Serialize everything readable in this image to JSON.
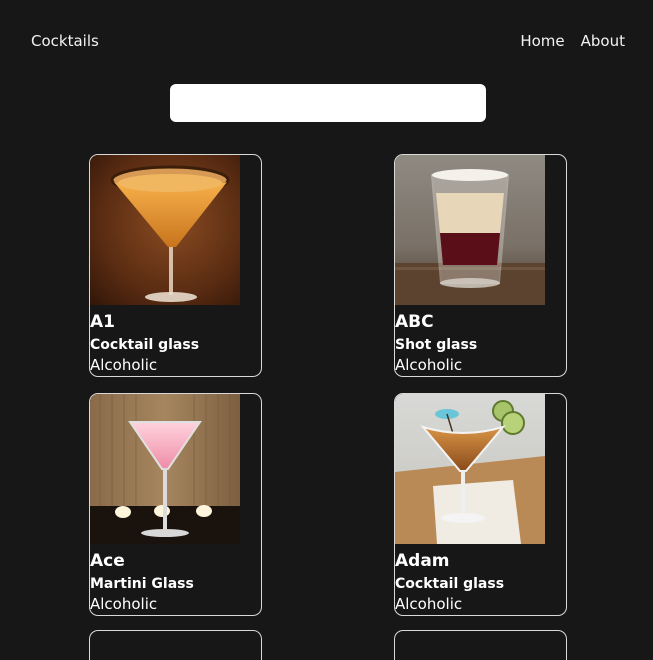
{
  "nav": {
    "brand": "Cocktails",
    "links": [
      {
        "label": "Home"
      },
      {
        "label": "About"
      }
    ]
  },
  "search": {
    "value": "",
    "placeholder": ""
  },
  "drinks": [
    {
      "name": "A1",
      "glass": "Cocktail glass",
      "type": "Alcoholic",
      "image": "amber-martini-photo"
    },
    {
      "name": "ABC",
      "glass": "Shot glass",
      "type": "Alcoholic",
      "image": "layered-shot-photo"
    },
    {
      "name": "Ace",
      "glass": "Martini Glass",
      "type": "Alcoholic",
      "image": "pink-martini-photo"
    },
    {
      "name": "Adam",
      "glass": "Cocktail glass",
      "type": "Alcoholic",
      "image": "garnished-martini-photo"
    }
  ],
  "colors": {
    "background": "#171717",
    "text": "#ffffff",
    "card_border": "#d9d9d9",
    "search_background": "#ffffff"
  }
}
